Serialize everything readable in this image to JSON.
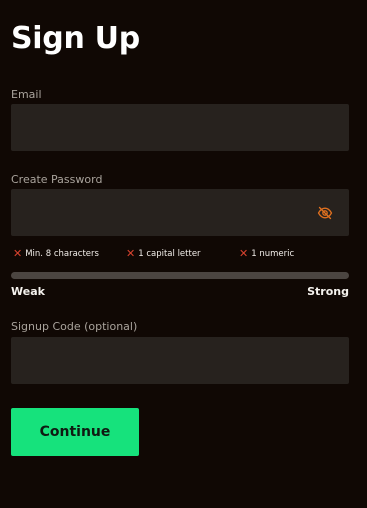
{
  "page": {
    "title": "Sign Up"
  },
  "form": {
    "email": {
      "label": "Email",
      "value": "",
      "placeholder": ""
    },
    "password": {
      "label": "Create Password",
      "value": "",
      "placeholder": "",
      "visibility_icon": "eye-off-icon"
    },
    "requirements": [
      {
        "label": "Min. 8 characters",
        "met": false
      },
      {
        "label": "1 capital letter",
        "met": false
      },
      {
        "label": "1 numeric",
        "met": false
      }
    ],
    "strength": {
      "weak_label": "Weak",
      "strong_label": "Strong",
      "level": 0
    },
    "signup_code": {
      "label": "Signup Code (optional)",
      "value": "",
      "placeholder": ""
    },
    "continue_label": "Continue"
  },
  "colors": {
    "background": "#100804",
    "field_background": "#27221e",
    "accent": "#16e27c",
    "error": "#d9432f",
    "track": "#4b4541"
  },
  "icons": {
    "requirement_unmet": "x-icon"
  }
}
